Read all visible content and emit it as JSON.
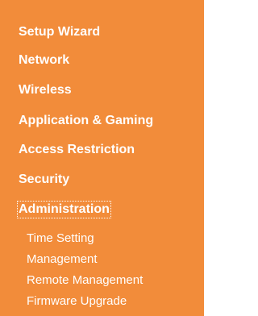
{
  "menu": {
    "items": [
      {
        "label": "Setup Wizard"
      },
      {
        "label": "Network"
      },
      {
        "label": "Wireless"
      },
      {
        "label": "Application & Gaming"
      },
      {
        "label": "Access Restriction"
      },
      {
        "label": "Security"
      },
      {
        "label": "Administration",
        "active": true
      }
    ],
    "subitems": [
      {
        "label": "Time Setting"
      },
      {
        "label": "Management"
      },
      {
        "label": "Remote Management"
      },
      {
        "label": "Firmware Upgrade"
      }
    ]
  },
  "colors": {
    "background": "#f28c3a",
    "text": "#ffffff"
  }
}
